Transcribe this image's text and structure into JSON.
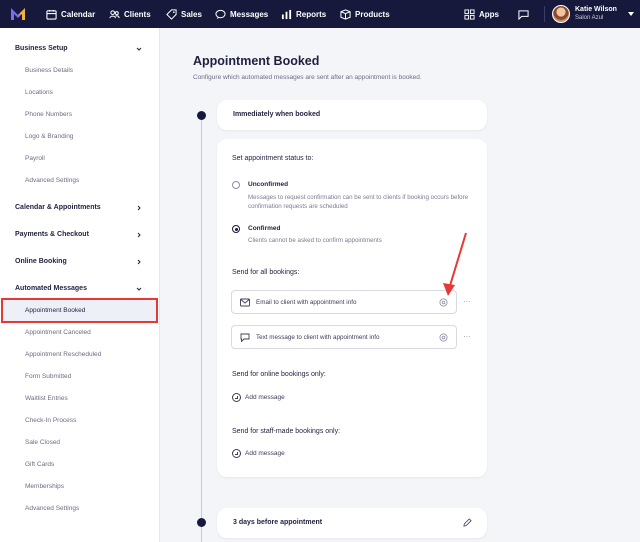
{
  "nav": {
    "items": [
      {
        "label": "Calendar",
        "icon": "calendar-icon"
      },
      {
        "label": "Clients",
        "icon": "clients-icon"
      },
      {
        "label": "Sales",
        "icon": "tag-icon"
      },
      {
        "label": "Messages",
        "icon": "chat-icon"
      },
      {
        "label": "Reports",
        "icon": "bar-chart-icon"
      },
      {
        "label": "Products",
        "icon": "box-icon"
      }
    ],
    "apps_label": "Apps",
    "user": {
      "name": "Katie Wilson",
      "business": "Salon Azul"
    },
    "colors": {
      "background": "#16193b",
      "text": "#ffffff"
    }
  },
  "sidebar": {
    "sections": [
      {
        "label": "Business Setup",
        "expanded": true
      },
      {
        "label": "Calendar & Appointments",
        "expanded": false
      },
      {
        "label": "Payments & Checkout",
        "expanded": false
      },
      {
        "label": "Online Booking",
        "expanded": false
      },
      {
        "label": "Automated Messages",
        "expanded": true
      }
    ],
    "business_setup_items": [
      "Business Details",
      "Locations",
      "Phone Numbers",
      "Logo & Branding",
      "Payroll",
      "Advanced Settings"
    ],
    "automated_messages_items": [
      "Appointment Booked",
      "Appointment Canceled",
      "Appointment Rescheduled",
      "Form Submitted",
      "Waitlist Entries",
      "Check-In Process",
      "Sale Closed",
      "Gift Cards",
      "Memberships",
      "Advanced Settings"
    ],
    "active_item": "Appointment Booked",
    "highlight_color": "#e53935"
  },
  "main": {
    "title": "Appointment Booked",
    "subtitle": "Configure which automated messages are sent after an appointment is booked.",
    "trigger_1": "Immediately when booked",
    "status_label": "Set appointment status to:",
    "options": [
      {
        "title": "Unconfirmed",
        "description": "Messages to request confirmation can be sent to clients if booking occurs before confirmation requests are scheduled",
        "selected": false
      },
      {
        "title": "Confirmed",
        "description": "Clients cannot be asked to confirm appointments",
        "selected": true
      }
    ],
    "all_bookings_label": "Send for all bookings:",
    "messages": [
      {
        "text": "Email to client with appointment info",
        "icon": "mail-icon"
      },
      {
        "text": "Text message to client with appointment info",
        "icon": "sms-icon"
      }
    ],
    "more_label": "···",
    "online_label": "Send for online bookings only:",
    "staff_label": "Send for staff-made bookings only:",
    "add_message_label": "Add message",
    "trigger_2": "3 days before appointment"
  }
}
